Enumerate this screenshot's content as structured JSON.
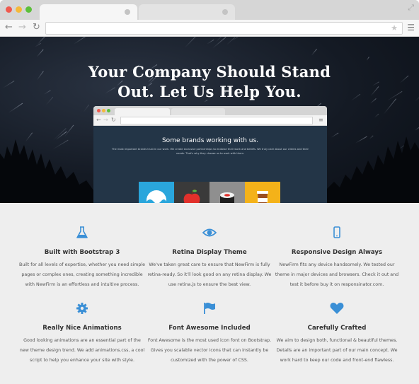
{
  "hero": {
    "title_line1": "Your Company Should Stand",
    "title_line2": "Out. Let Us Help You."
  },
  "mini_browser": {
    "heading": "Some brands working with us.",
    "subtext": "The most important brands trust in our work. We create exclusive partnerships to endorse their work and beliefs. We truly care about our clients and their needs. That's why they choose us to work with them."
  },
  "features": [
    {
      "icon": "flask-icon",
      "title": "Built with Bootstrap 3",
      "text": "Built for all levels of expertise, whether you need simple pages or complex ones, creating something incredible with NewFirm is an effortless and intuitive process."
    },
    {
      "icon": "eye-icon",
      "title": "Retina Display Theme",
      "text": "We've taken great care to ensure that NewFirm is fully retina-ready. So it'll look good on any retina display. We use retina.js to ensure the best view."
    },
    {
      "icon": "mobile-icon",
      "title": "Responsive Design Always",
      "text": "NewFirm fits any device handsomely. We tested our theme in major devices and browsers. Check it out and test it before buy it on responsinator.com."
    },
    {
      "icon": "gear-icon",
      "title": "Really Nice Animations",
      "text": "Good looking animations are an essential part of the new theme design trend. We add animations.css, a cool script to help you enhance your site with style."
    },
    {
      "icon": "flag-icon",
      "title": "Font Awesome Included",
      "text": "Font Awesome is the most used icon font on Bootstrap. Gives you scalable vector icons that can instantly be customized with the power of CSS."
    },
    {
      "icon": "heart-icon",
      "title": "Carefully Crafted",
      "text": "We aim to design both, functional & beautiful themes. Details are an important part of our main concept. We work hard to keep our code and front-end flawless."
    }
  ],
  "colors": {
    "accent": "#3a8fd6",
    "hero_bg": "#141a24",
    "mini_content_bg": "#233547",
    "features_bg": "#eeeeee"
  }
}
